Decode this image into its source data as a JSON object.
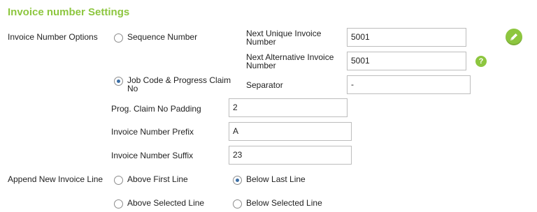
{
  "section_title": "Invoice number Settings",
  "invoice_number_options": {
    "label": "Invoice Number Options",
    "option_sequence": "Sequence Number",
    "option_job_code": "Job Code & Progress Claim No",
    "selected": "job_code"
  },
  "next_unique": {
    "label": "Next Unique Invoice Number",
    "value": "5001"
  },
  "next_alternative": {
    "label": "Next Alternative Invoice Number",
    "value": "5001"
  },
  "separator": {
    "label": "Separator",
    "value": "-"
  },
  "prog_claim_padding": {
    "label": "Prog. Claim No Padding",
    "value": "2"
  },
  "invoice_prefix": {
    "label": "Invoice Number Prefix",
    "value": "A"
  },
  "invoice_suffix": {
    "label": "Invoice Number Suffix",
    "value": "23"
  },
  "append_new_line": {
    "label": "Append New Invoice Line",
    "options": [
      {
        "label": "Above First Line",
        "checked": false
      },
      {
        "label": "Below Last Line",
        "checked": true
      },
      {
        "label": "Above Selected Line",
        "checked": false
      },
      {
        "label": "Below Selected Line",
        "checked": false
      }
    ]
  },
  "icons": {
    "edit": "edit-pencil-icon",
    "help": "help-question-icon",
    "help_glyph": "?"
  },
  "colors": {
    "accent": "#8dc63f",
    "radio_dot": "#3b6ea5"
  }
}
